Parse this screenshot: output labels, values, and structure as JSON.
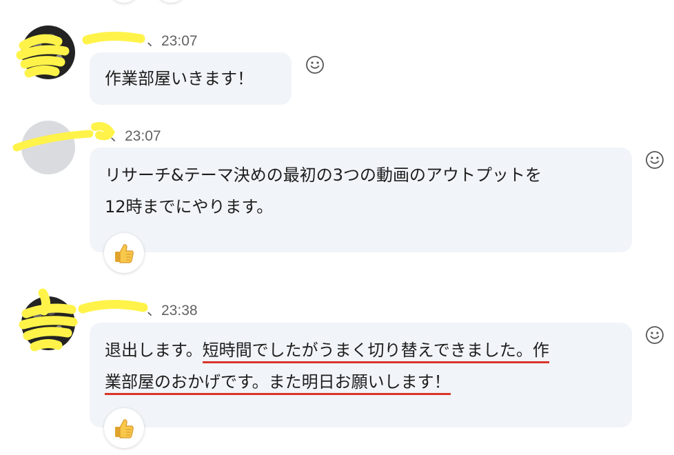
{
  "messages": [
    {
      "name": "",
      "time": "、23:07",
      "lines": [
        "作業部屋いきます！"
      ],
      "reaction_icon": null
    },
    {
      "name": "",
      "time": "、23:07",
      "lines": [
        "リサーチ&テーマ決めの最初の3つの動画のアウトプットを",
        "12時までにやります。"
      ],
      "reaction_icon": "thumbs-up"
    },
    {
      "name": "",
      "time": "、23:38",
      "line1_plain": "退出します。",
      "line1_marked": "短時間でしたがうまく切り替えできました。作",
      "line2_marked": "業部屋のおかげです。また明日お願いします！",
      "reaction_icon": "thumbs-up"
    }
  ],
  "icons": {
    "add_reaction": "smiley-face-icon",
    "reaction": "thumbs-up-icon"
  },
  "colors": {
    "bubble_bg": "#f1f4f8",
    "underline": "#d9342b",
    "redaction": "#fff34a",
    "meta_text": "#616161"
  }
}
